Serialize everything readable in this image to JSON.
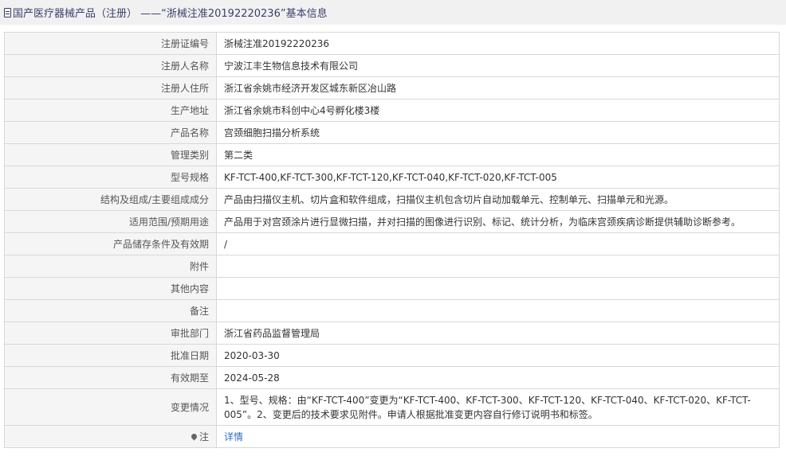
{
  "header": {
    "title": "国产医疗器械产品（注册） ——“浙械注准20192220236”基本信息",
    "icon": "document-icon"
  },
  "rows": [
    {
      "label": "注册证编号",
      "value": "浙械注准20192220236"
    },
    {
      "label": "注册人名称",
      "value": "宁波江丰生物信息技术有限公司"
    },
    {
      "label": "注册人住所",
      "value": "浙江省余姚市经济开发区城东新区冶山路"
    },
    {
      "label": "生产地址",
      "value": "浙江省余姚市科创中心4号孵化楼3楼"
    },
    {
      "label": "产品名称",
      "value": "宫颈细胞扫描分析系统"
    },
    {
      "label": "管理类别",
      "value": "第二类"
    },
    {
      "label": "型号规格",
      "value": "KF-TCT-400,KF-TCT-300,KF-TCT-120,KF-TCT-040,KF-TCT-020,KF-TCT-005"
    },
    {
      "label": "结构及组成/主要组成成分",
      "value": "产品由扫描仪主机、切片盒和软件组成，扫描仪主机包含切片自动加载单元、控制单元、扫描单元和光源。"
    },
    {
      "label": "适用范围/预期用途",
      "value": "产品用于对宫颈涂片进行显微扫描，并对扫描的图像进行识别、标记、统计分析，为临床宫颈疾病诊断提供辅助诊断参考。"
    },
    {
      "label": "产品储存条件及有效期",
      "value": "/"
    },
    {
      "label": "附件",
      "value": ""
    },
    {
      "label": "其他内容",
      "value": ""
    },
    {
      "label": "备注",
      "value": ""
    },
    {
      "label": "审批部门",
      "value": "浙江省药品监督管理局"
    },
    {
      "label": "批准日期",
      "value": "2020-03-30"
    },
    {
      "label": "有效期至",
      "value": "2024-05-28"
    },
    {
      "label": "变更情况",
      "value": "1、型号、规格：由“KF-TCT-400”变更为“KF-TCT-400、KF-TCT-300、KF-TCT-120、KF-TCT-040、KF-TCT-020、KF-TCT-005”。2、变更后的技术要求见附件。申请人根据批准变更内容自行修订说明书和标签。"
    }
  ],
  "note": {
    "icon": "pin-icon",
    "label": "注",
    "link_text": "详情"
  }
}
